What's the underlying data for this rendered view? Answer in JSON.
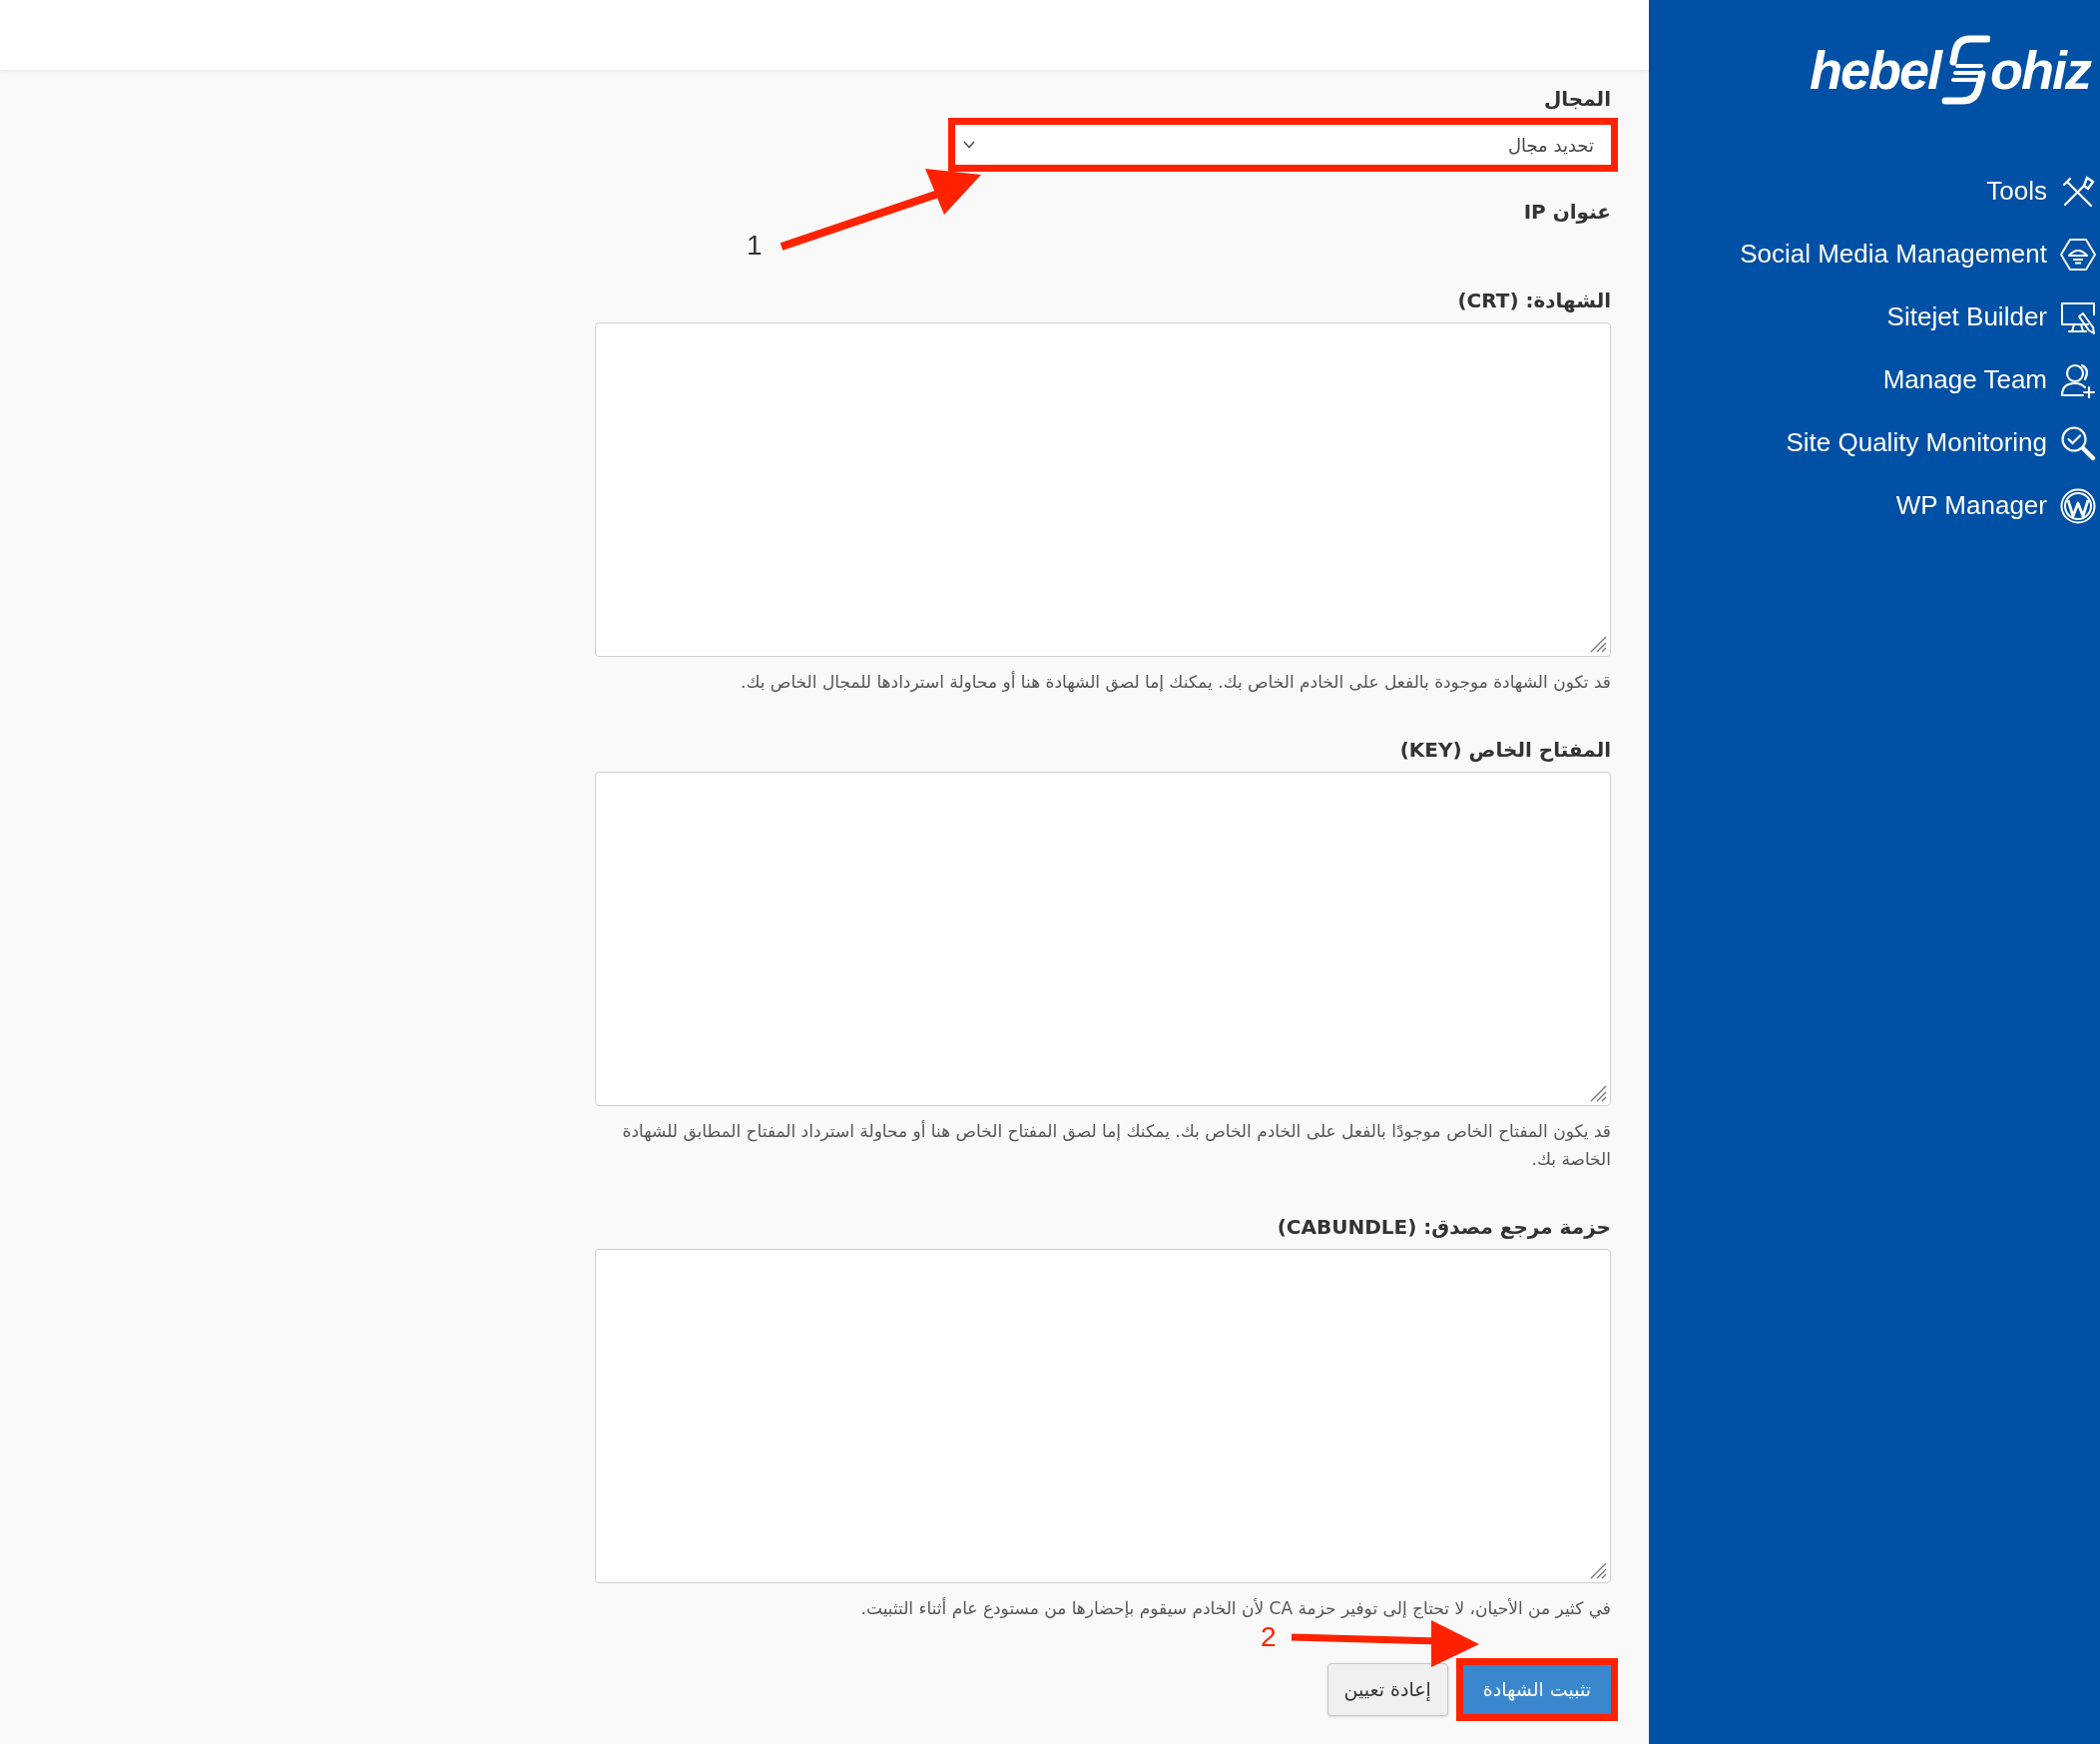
{
  "form": {
    "fields": [
      {
        "kind": "select",
        "label": "المجال",
        "value": "تحديد مجال",
        "highlighted": true
      },
      {
        "kind": "static",
        "label": "عنوان IP"
      },
      {
        "kind": "textarea",
        "label": "الشهادة: (CRT)",
        "help": "قد تكون الشهادة موجودة بالفعل على الخادم الخاص بك. يمكنك إما لصق الشهادة هنا أو محاولة استردادها للمجال الخاص بك."
      },
      {
        "kind": "textarea",
        "label": "المفتاح الخاص (KEY)",
        "help": "قد يكون المفتاح الخاص موجودًا بالفعل على الخادم الخاص بك. يمكنك إما لصق المفتاح الخاص هنا أو محاولة استرداد المفتاح المطابق للشهادة الخاصة بك."
      },
      {
        "kind": "textarea",
        "label": "حزمة مرجع مصدق: (CABUNDLE)",
        "help": "في كثير من الأحيان، لا تحتاج إلى توفير حزمة CA لأن الخادم سيقوم بإحضارها من مستودع عام أثناء التثبيت."
      }
    ],
    "buttons": [
      {
        "label": "تثبيت الشهادة",
        "kind": "primary",
        "highlighted": true
      },
      {
        "label": "إعادة تعيين",
        "kind": "secondary",
        "highlighted": false
      }
    ]
  },
  "annotations": [
    {
      "label": "1",
      "color": "#333333"
    },
    {
      "label": "2",
      "color": "#ff2200"
    }
  ],
  "sidebar": {
    "logo": {
      "text_before_mark": "hebel",
      "text_after_mark": "ohiz"
    },
    "items": [
      {
        "label": "Tools"
      },
      {
        "label": "Social Media Management"
      },
      {
        "label": "Sitejet Builder"
      },
      {
        "label": "Manage Team"
      },
      {
        "label": "Site Quality Monitoring"
      },
      {
        "label": "WP Manager"
      }
    ]
  }
}
